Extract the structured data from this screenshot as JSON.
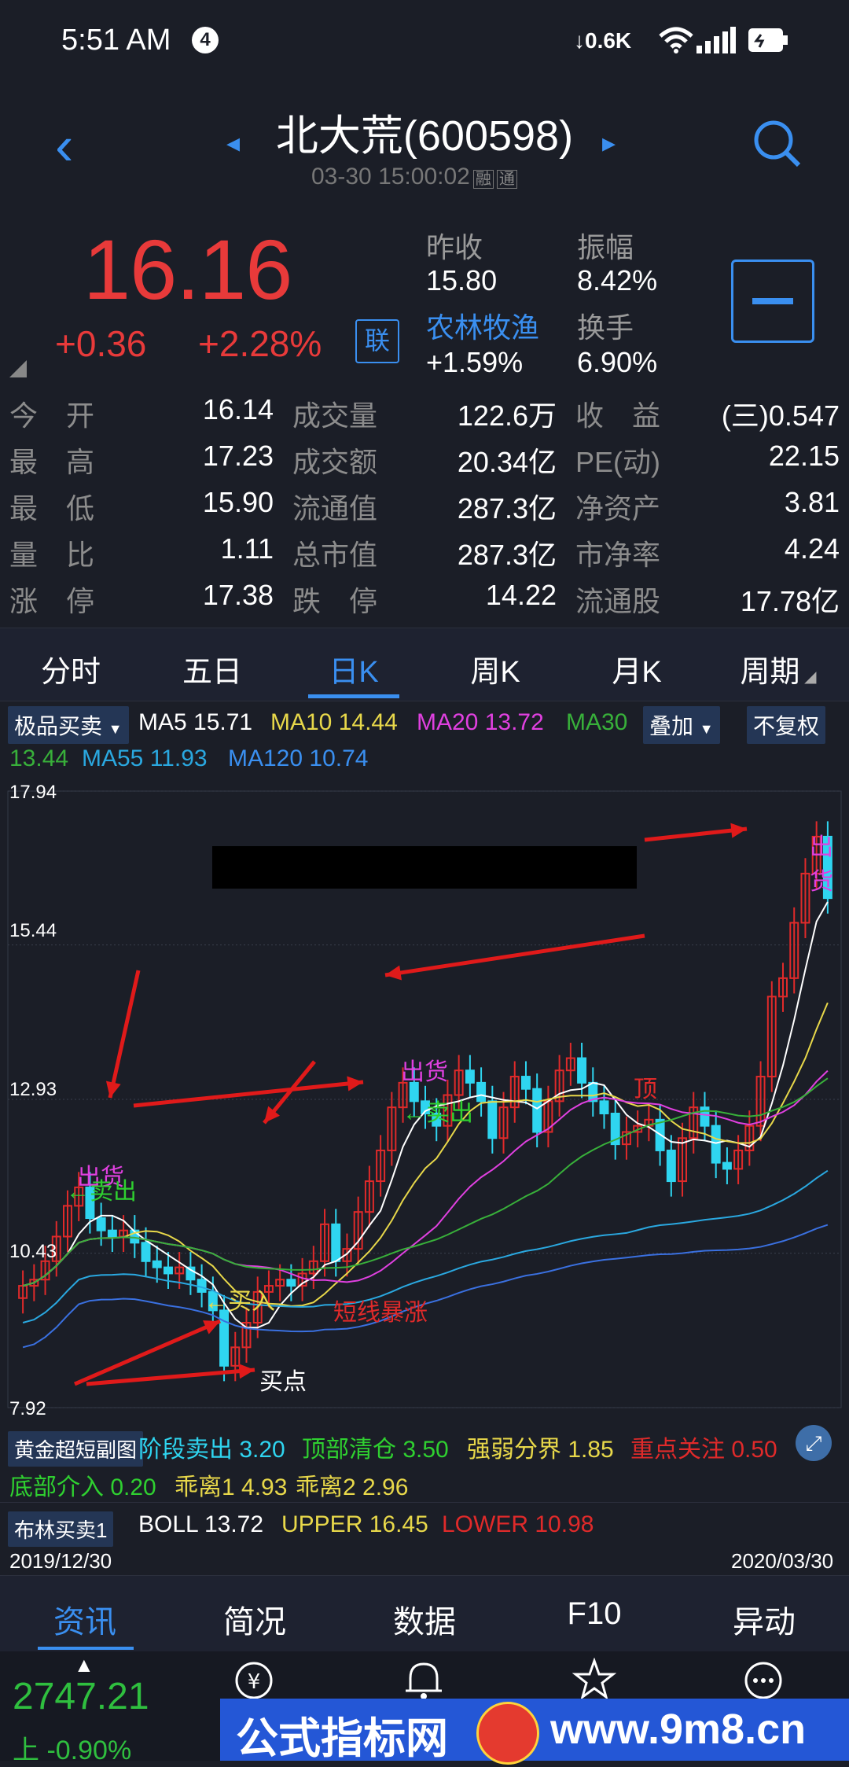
{
  "status_bar": {
    "time": "5:51 AM",
    "notification_count": "4",
    "net_speed": "0.6K"
  },
  "header": {
    "title": "北大荒(600598)",
    "datetime": "03-30 15:00:02",
    "tags": [
      "融",
      "通"
    ]
  },
  "quote": {
    "price": "16.16",
    "change": "+0.36",
    "change_pct": "+2.28%",
    "lian_label": "联",
    "prev_close_label": "昨收",
    "prev_close": "15.80",
    "amplitude_label": "振幅",
    "amplitude": "8.42%",
    "sector": "农林牧渔",
    "sector_change": "+1.59%",
    "turnover_label": "换手",
    "turnover": "6.90%"
  },
  "stats": [
    [
      [
        "今　开",
        "16.14"
      ],
      [
        "成交量",
        "122.6万"
      ],
      [
        "收　益",
        "(三)0.547"
      ]
    ],
    [
      [
        "最　高",
        "17.23"
      ],
      [
        "成交额",
        "20.34亿"
      ],
      [
        "PE(动)",
        "22.15"
      ]
    ],
    [
      [
        "最　低",
        "15.90"
      ],
      [
        "流通值",
        "287.3亿"
      ],
      [
        "净资产",
        "3.81"
      ]
    ],
    [
      [
        "量　比",
        "1.11"
      ],
      [
        "总市值",
        "287.3亿"
      ],
      [
        "市净率",
        "4.24"
      ]
    ],
    [
      [
        "涨　停",
        "17.38"
      ],
      [
        "跌　停",
        "14.22"
      ],
      [
        "流通股",
        "17.78亿"
      ]
    ]
  ],
  "period_tabs": [
    "分时",
    "五日",
    "日K",
    "周K",
    "月K",
    "周期"
  ],
  "ma_row": {
    "indicator_chip": "极品买卖",
    "ma5": "MA5",
    "ma5_val": "15.71",
    "ma10": "MA10",
    "ma10_val": "14.44",
    "ma20": "MA20",
    "ma20_val": "13.72",
    "ma30": "MA30",
    "ma30_val": "13.44",
    "ma55": "MA55",
    "ma55_val": "11.93",
    "ma120": "MA120",
    "ma120_val": "10.74",
    "overlay_chip": "叠加",
    "fq_chip": "不复权"
  },
  "chart": {
    "y_ticks": [
      "17.94",
      "15.44",
      "12.93",
      "10.43",
      "7.92"
    ],
    "annotations": {
      "sell_goods_1": "出货",
      "sell_goods_2": "出货",
      "sell_goods_3": "出货",
      "sell_1": "←卖出",
      "sell_2": "←卖出",
      "buy": "←买入",
      "top": "顶",
      "short_surge": "短线暴涨",
      "buy_point": "买点"
    },
    "colors": {
      "up": "#e02a2a",
      "down": "#2fd5f0",
      "ma5": "#ffffff",
      "ma10": "#e8d84a",
      "ma20": "#e040e0",
      "ma30": "#38b03a",
      "ma55": "#2aa8e0",
      "ma120": "#3a70e0"
    }
  },
  "chart_data": {
    "type": "candlestick",
    "ylim": [
      7.92,
      17.94
    ],
    "y_ticks": [
      17.94,
      15.44,
      12.93,
      10.43,
      7.92
    ],
    "x_start": "2019/12/30",
    "x_end": "2020/03/30"
  },
  "indicators": {
    "chip1": "黄金超短副图",
    "stage_sell": "阶段卖出",
    "stage_sell_val": "3.20",
    "top_clear": "顶部清仓",
    "top_clear_val": "3.50",
    "strength_line": "强弱分界",
    "strength_line_val": "1.85",
    "focus": "重点关注",
    "focus_val": "0.50",
    "bottom_in": "底部介入",
    "bottom_in_val": "0.20",
    "dev1": "乖离1",
    "dev1_val": "4.93",
    "dev2": "乖离2",
    "dev2_val": "2.96",
    "chip2": "布林买卖1",
    "boll": "BOLL",
    "boll_val": "13.72",
    "upper": "UPPER",
    "upper_val": "16.45",
    "lower": "LOWER",
    "lower_val": "10.98"
  },
  "dates": {
    "start": "2019/12/30",
    "end": "2020/03/30"
  },
  "bottom_tabs": [
    "资讯",
    "简况",
    "数据",
    "F10",
    "异动"
  ],
  "bottom_bar": {
    "index_value": "2747.21",
    "index_prefix": "上",
    "index_change": "-0.90%",
    "watermark_left": "公式指标网",
    "watermark_right": "www.9m8.cn"
  }
}
